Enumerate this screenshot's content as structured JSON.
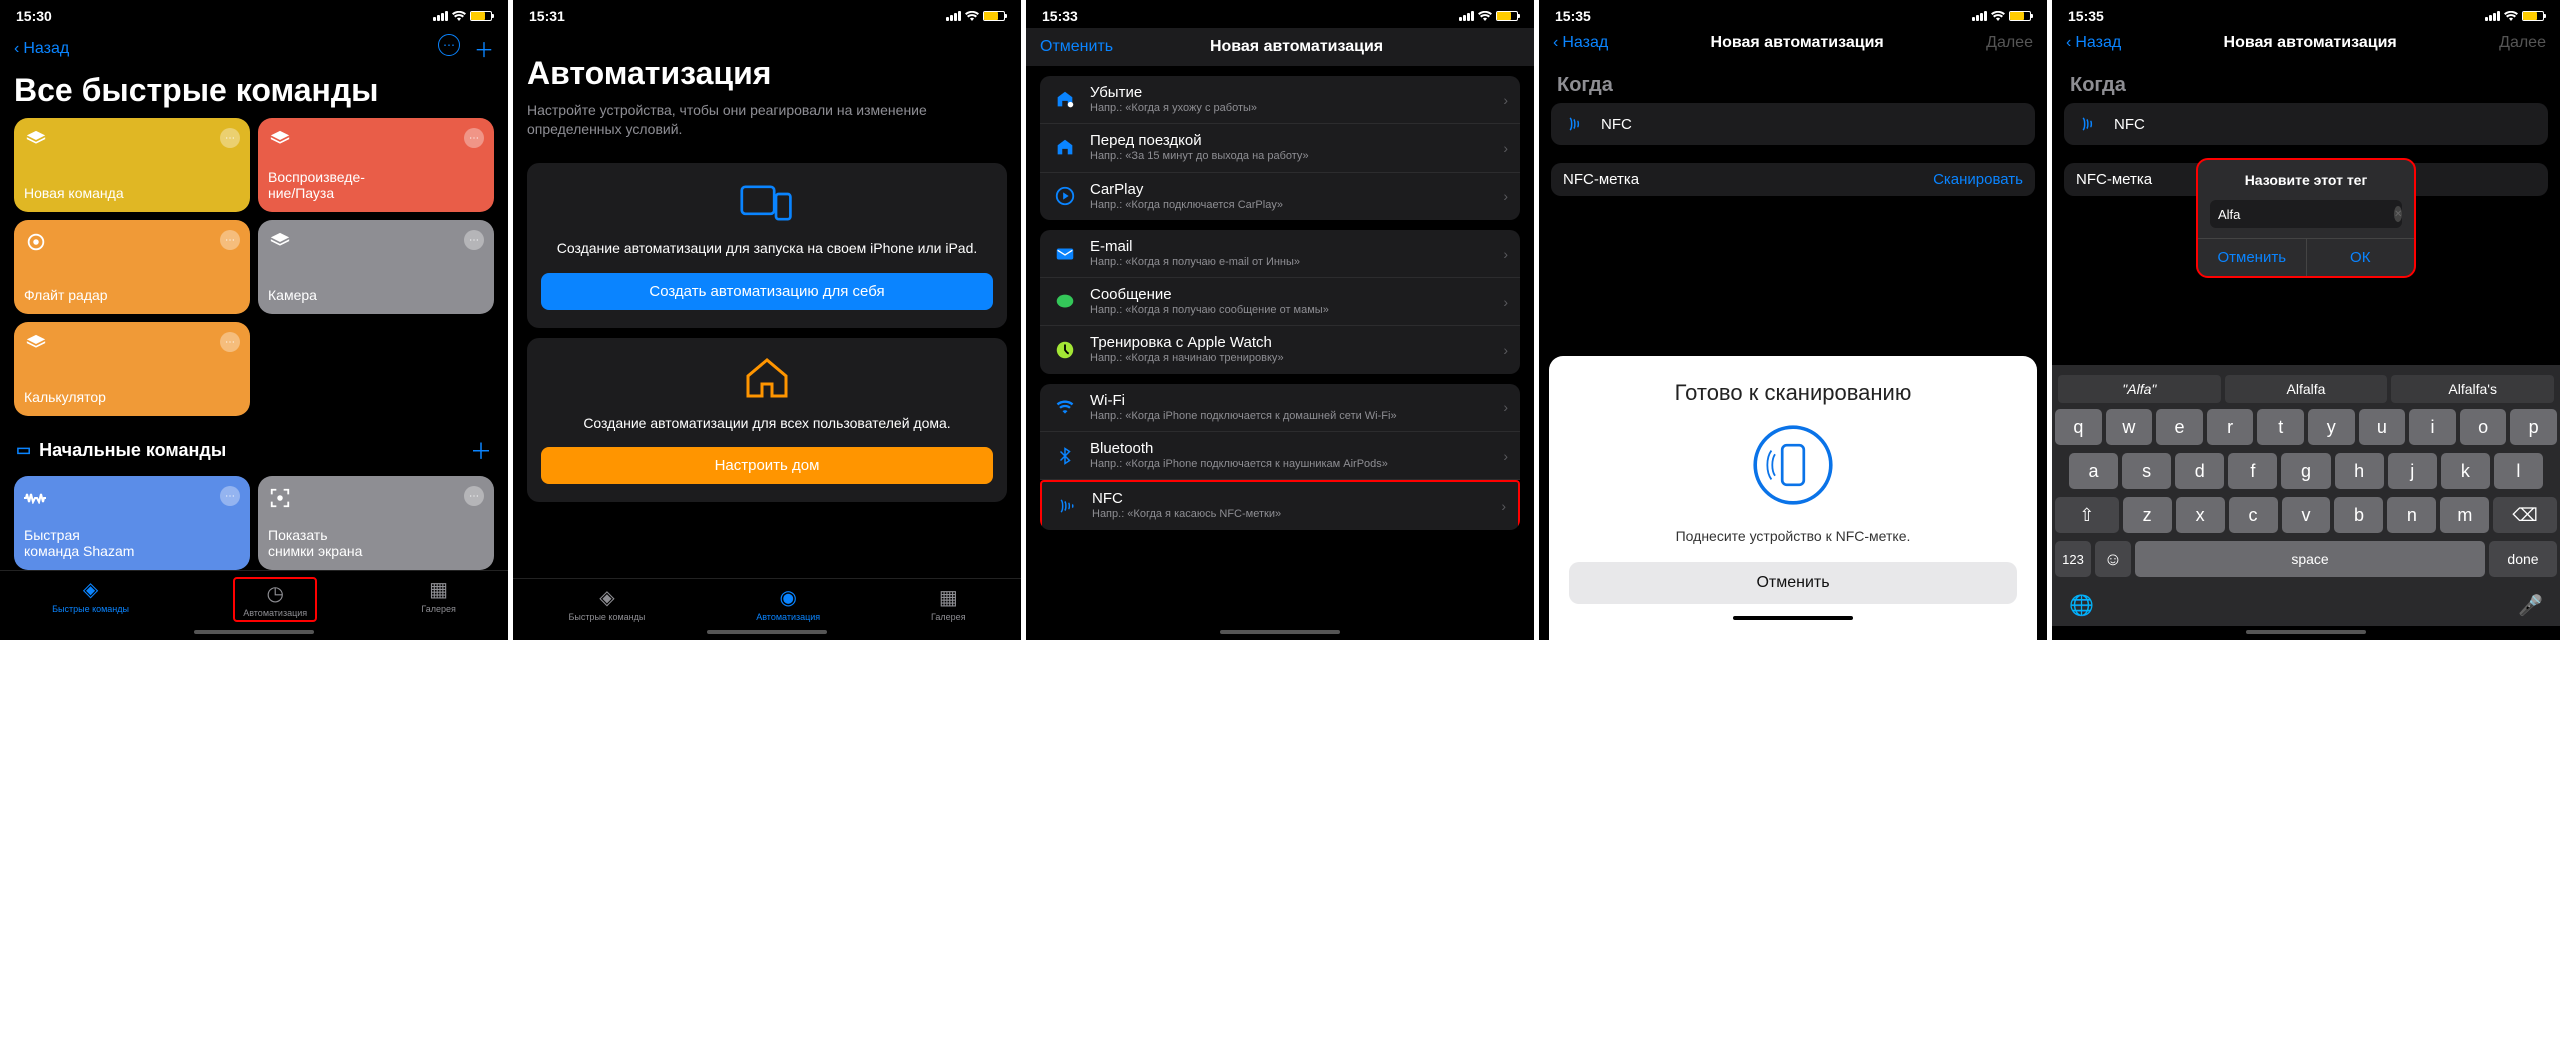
{
  "screens": [
    {
      "time": "15:30"
    },
    {
      "time": "15:31"
    },
    {
      "time": "15:33"
    },
    {
      "time": "15:35"
    },
    {
      "time": "15:35"
    }
  ],
  "screen1": {
    "back": "Назад",
    "title": "Все быстрые команды",
    "tiles": [
      {
        "label": "Новая команда"
      },
      {
        "label": "Воспроизведе-\nние/Пауза"
      },
      {
        "label": "Флайт радар"
      },
      {
        "label": "Камера"
      },
      {
        "label": "Калькулятор"
      }
    ],
    "section": "Начальные команды",
    "grid_tiles": [
      {
        "label": "Быстрая\nкоманда Shazam"
      },
      {
        "label": "Показать\nснимки экрана"
      }
    ],
    "tabs": [
      "Быстрые команды",
      "Автоматизация",
      "Галерея"
    ]
  },
  "screen2": {
    "title": "Автоматизация",
    "subtitle": "Настройте устройства, чтобы они реагировали на изменение определенных условий.",
    "card1_text": "Создание автоматизации для запуска на своем iPhone или iPad.",
    "card1_btn": "Создать автоматизацию для себя",
    "card2_text": "Создание автоматизации для всех пользователей дома.",
    "card2_btn": "Настроить дом",
    "tabs": [
      "Быстрые команды",
      "Автоматизация",
      "Галерея"
    ]
  },
  "screen3": {
    "cancel": "Отменить",
    "title": "Новая автоматизация",
    "groups": [
      {
        "items": [
          {
            "title": "Убытие",
            "subtitle": "Напр.: «Когда я ухожу с работы»",
            "icon": "home-leave",
            "color": "#0a84ff"
          },
          {
            "title": "Перед поездкой",
            "subtitle": "Напр.: «За 15 минут до выхода на работу»",
            "icon": "home-before",
            "color": "#0a84ff"
          },
          {
            "title": "CarPlay",
            "subtitle": "Напр.: «Когда подключается CarPlay»",
            "icon": "carplay",
            "color": "#0a84ff"
          }
        ]
      },
      {
        "items": [
          {
            "title": "E-mail",
            "subtitle": "Напр.: «Когда я получаю e-mail от Инны»",
            "icon": "mail",
            "color": "#0a84ff"
          },
          {
            "title": "Сообщение",
            "subtitle": "Напр.: «Когда я получаю сообщение от мамы»",
            "icon": "message",
            "color": "#34c759"
          },
          {
            "title": "Тренировка с Apple Watch",
            "subtitle": "Напр.: «Когда я начинаю тренировку»",
            "icon": "workout",
            "color": "#a3e635"
          }
        ]
      },
      {
        "items": [
          {
            "title": "Wi-Fi",
            "subtitle": "Напр.: «Когда iPhone подключается к домашней сети Wi-Fi»",
            "icon": "wifi",
            "color": "#0a84ff"
          },
          {
            "title": "Bluetooth",
            "subtitle": "Напр.: «Когда iPhone подключается к наушникам AirPods»",
            "icon": "bluetooth",
            "color": "#0a84ff"
          },
          {
            "title": "NFC",
            "subtitle": "Напр.: «Когда я касаюсь NFC-метки»",
            "icon": "nfc",
            "color": "#0a84ff"
          }
        ]
      }
    ]
  },
  "screen4": {
    "back": "Назад",
    "title": "Новая автоматизация",
    "next": "Далее",
    "when": "Когда",
    "nfc_label": "NFC",
    "tag_label": "NFC-метка",
    "tag_action": "Сканировать",
    "sheet_title": "Готово к сканированию",
    "sheet_text": "Поднесите устройство к NFC-метке.",
    "sheet_cancel": "Отменить"
  },
  "screen5": {
    "back": "Назад",
    "title": "Новая автоматизация",
    "next": "Далее",
    "when": "Когда",
    "nfc_label": "NFC",
    "tag_label": "NFC-метка",
    "alert_title": "Назовите этот тег",
    "alert_input": "Alfa",
    "alert_cancel": "Отменить",
    "alert_ok": "ОК",
    "suggestions": [
      "\"Alfa\"",
      "Alfalfa",
      "Alfalfa's"
    ],
    "key_done": "done",
    "key_space": "space",
    "key_123": "123"
  }
}
